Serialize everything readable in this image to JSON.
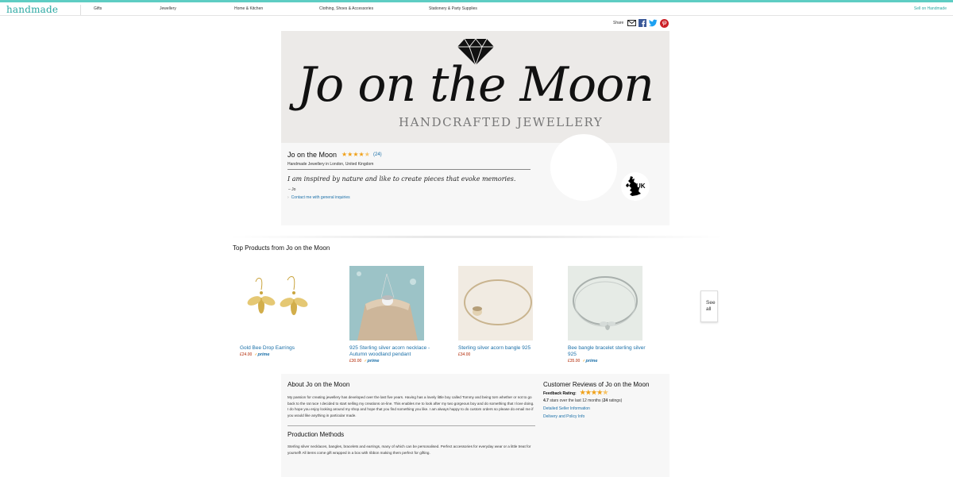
{
  "nav": {
    "logo": "handmade",
    "items": [
      "Gifts",
      "Jewellery",
      "Home & Kitchen",
      "Clothing, Shoes & Accessories",
      "Stationery & Party Supplies"
    ],
    "sell_link": "Sell on Handmade"
  },
  "share": {
    "label": "Share",
    "icons": [
      "email-icon",
      "facebook-icon",
      "twitter-icon",
      "pinterest-icon"
    ]
  },
  "banner": {
    "title": "Jo on the Moon",
    "subtitle": "HANDCRAFTED JEWELLERY"
  },
  "profile": {
    "shop_name": "Jo on the Moon",
    "rating_stars": 4.7,
    "rating_count": "(24)",
    "location": "Handmade Jewellery in London, United Kingdom",
    "quote": "I am inspired by nature and like to create pieces that evoke memories.",
    "quote_author": "– Jo",
    "contact_link": "Contact me with general inquiries",
    "country_badge": "UK"
  },
  "products": {
    "title": "Top Products from Jo on the Moon",
    "see_all": "See all",
    "items": [
      {
        "name": "Gold Bee Drop Earrings",
        "price": "£24.00",
        "prime": "prime"
      },
      {
        "name": "925 Sterling silver acorn necklace - Autumn woodland pendant",
        "price": "£30.00",
        "prime": "prime"
      },
      {
        "name": "Sterling silver acorn bangle 925",
        "price": "£34.00",
        "prime": ""
      },
      {
        "name": "Bee bangle bracelet sterling silver 925",
        "price": "£35.00",
        "prime": "prime"
      }
    ]
  },
  "about": {
    "title": "About Jo on the Moon",
    "text": "My passion for creating jewellery has developed over the last five years. Having has a lovely little boy called Tommy and being torn whether or not to go back to the rat race I decided to start selling my creations on-line. This enables me to look after my two gorgeous boy and do something that I love doing. I do hope you enjoy looking around my shop and hope that you find something you like. I am always happy to do custom orders so please do email me if you would like anything in particular made.",
    "production_title": "Production Methods",
    "production_text": "Sterling silver necklaces, bangles, bracelets and earrings, many of which can be personalised. Perfect accessories for everyday wear or a little treat for yourself! All items come gift wrapped in a box with ribbon making them perfect for gifting."
  },
  "reviews": {
    "title": "Customer Reviews of Jo on the Moon",
    "feedback_label": "Feedback Rating:",
    "score": "4.7",
    "stars_text": "stars over the last 12 months",
    "ratings_count": "24",
    "ratings_suffix": "ratings",
    "link_seller": "Detailed Seller Information",
    "link_policy": "Delivery and Policy Info"
  },
  "colors": {
    "accent": "#5ecdc3",
    "link": "#1a6fa8",
    "price": "#b12704",
    "star": "#f0a11a"
  }
}
